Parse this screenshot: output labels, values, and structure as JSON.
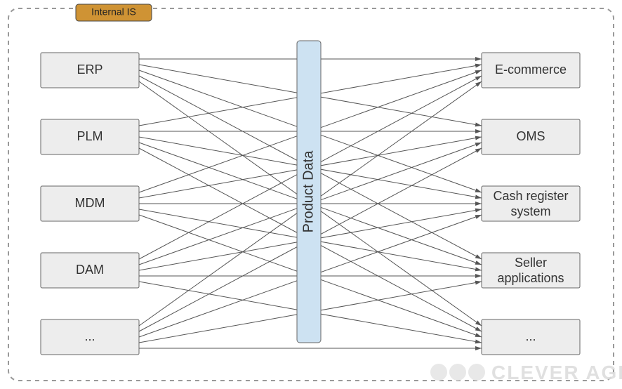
{
  "frame": {
    "tag_label": "Internal IS"
  },
  "left_nodes": [
    {
      "label": "ERP"
    },
    {
      "label": "PLM"
    },
    {
      "label": "MDM"
    },
    {
      "label": "DAM"
    },
    {
      "label": "..."
    }
  ],
  "center": {
    "label": "Product Data"
  },
  "right_nodes": [
    {
      "label": "E-commerce"
    },
    {
      "label": "OMS"
    },
    {
      "label": "Cash register system",
      "multiline": [
        "Cash register",
        "system"
      ]
    },
    {
      "label": "Seller applications",
      "multiline": [
        "Seller",
        "applications"
      ]
    },
    {
      "label": "..."
    }
  ],
  "watermark": {
    "text": "CLEVER AGE"
  }
}
